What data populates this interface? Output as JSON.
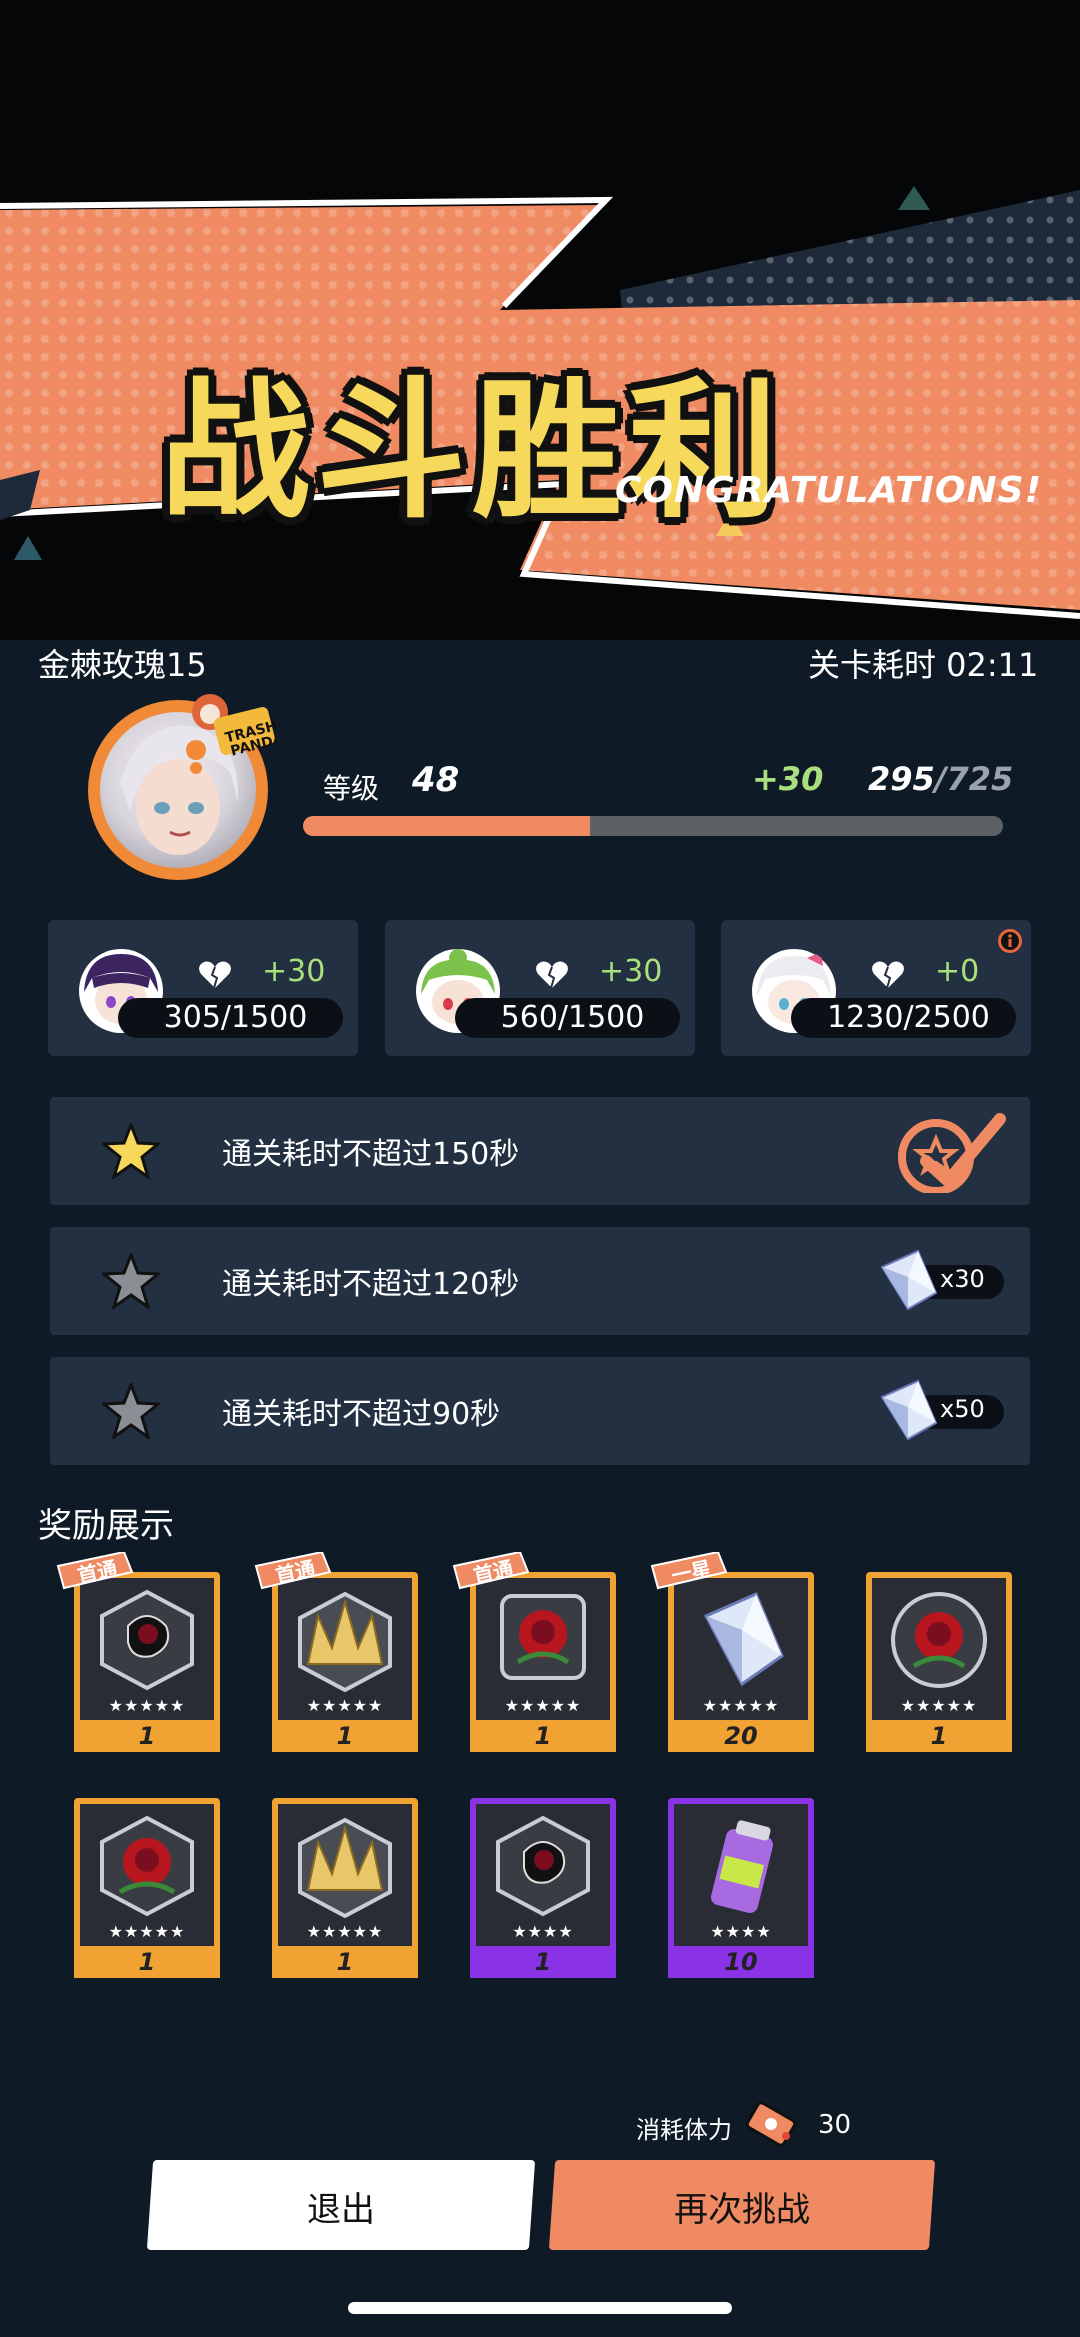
{
  "banner": {
    "title": "战斗胜利",
    "subtitle": "CONGRATULATIONS!"
  },
  "header": {
    "player_name": "金棘玫瑰15",
    "time_label": "关卡耗时 02:11"
  },
  "level": {
    "label": "等级",
    "value": "48",
    "exp_gain": "+30",
    "exp_current": "295",
    "exp_max": "/725",
    "progress": 0.41
  },
  "affinity": [
    {
      "gain": "+30",
      "value": "305/1500"
    },
    {
      "gain": "+30",
      "value": "560/1500"
    },
    {
      "gain": "+0",
      "value": "1230/2500"
    }
  ],
  "missions": [
    {
      "text": "通关耗时不超过150秒",
      "achieved": true,
      "reward": ""
    },
    {
      "text": "通关耗时不超过120秒",
      "achieved": false,
      "reward": "x30"
    },
    {
      "text": "通关耗时不超过90秒",
      "achieved": false,
      "reward": "x50"
    }
  ],
  "rewards_title": "奖励展示",
  "rewards": [
    {
      "tag": "首通",
      "stars": "★★★★★",
      "count": "1",
      "rarity": "gold",
      "icon": "black-rose-hex-icon"
    },
    {
      "tag": "首通",
      "stars": "★★★★★",
      "count": "1",
      "rarity": "gold",
      "icon": "golden-crown-icon"
    },
    {
      "tag": "首通",
      "stars": "★★★★★",
      "count": "1",
      "rarity": "gold",
      "icon": "red-rose-shield-icon"
    },
    {
      "tag": "一星",
      "stars": "★★★★★",
      "count": "20",
      "rarity": "gold",
      "icon": "crystal-icon"
    },
    {
      "tag": "",
      "stars": "★★★★★",
      "count": "1",
      "rarity": "gold",
      "icon": "red-rose-round-icon"
    },
    {
      "tag": "",
      "stars": "★★★★★",
      "count": "1",
      "rarity": "gold",
      "icon": "red-rose-hex-icon"
    },
    {
      "tag": "",
      "stars": "★★★★★",
      "count": "1",
      "rarity": "gold",
      "icon": "golden-crown-icon"
    },
    {
      "tag": "",
      "stars": "★★★★",
      "count": "1",
      "rarity": "purple",
      "icon": "black-rose-hex-icon"
    },
    {
      "tag": "",
      "stars": "★★★★",
      "count": "10",
      "rarity": "purple",
      "icon": "drink-can-icon"
    }
  ],
  "footer": {
    "stamina_label": "消耗体力",
    "stamina_value": "30",
    "exit_label": "退出",
    "retry_label": "再次挑战"
  },
  "colors": {
    "accent": "#ef8a62",
    "gold_frame": "#f0a232",
    "purple_frame": "#8a32e6",
    "green_text": "#a9e07d",
    "card_bg": "#223041",
    "page_bg": "#0e1a26"
  }
}
